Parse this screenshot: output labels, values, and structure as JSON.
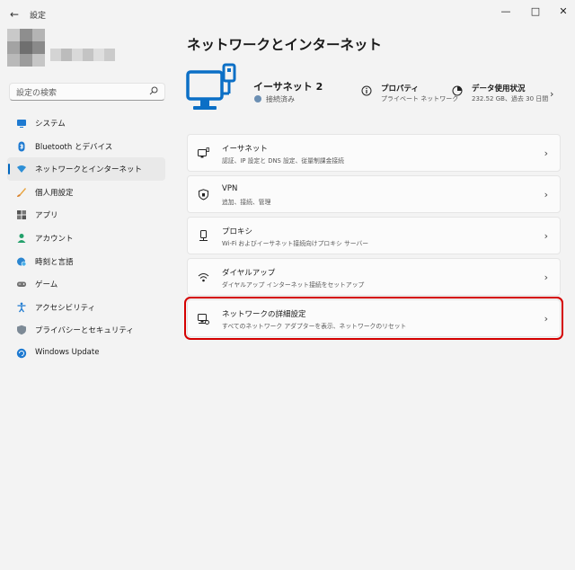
{
  "window": {
    "title": "設定",
    "back_glyph": "←",
    "controls": {
      "minimize": "—",
      "maximize": "□",
      "close": "✕"
    }
  },
  "sidebar": {
    "search": {
      "placeholder": "設定の検索"
    },
    "items": [
      {
        "label": "システム",
        "icon": "monitor-icon"
      },
      {
        "label": "Bluetooth とデバイス",
        "icon": "bluetooth-icon"
      },
      {
        "label": "ネットワークとインターネット",
        "icon": "wifi-icon",
        "active": true
      },
      {
        "label": "個人用設定",
        "icon": "brush-icon"
      },
      {
        "label": "アプリ",
        "icon": "apps-icon"
      },
      {
        "label": "アカウント",
        "icon": "person-icon"
      },
      {
        "label": "時刻と言語",
        "icon": "globe-clock-icon"
      },
      {
        "label": "ゲーム",
        "icon": "gamepad-icon"
      },
      {
        "label": "アクセシビリティ",
        "icon": "accessibility-icon"
      },
      {
        "label": "プライバシーとセキュリティ",
        "icon": "shield-icon"
      },
      {
        "label": "Windows Update",
        "icon": "update-icon"
      }
    ]
  },
  "main": {
    "title": "ネットワークとインターネット",
    "connection": {
      "name": "イーサネット 2",
      "status": "接続済み"
    },
    "properties": {
      "title": "プロパティ",
      "subtitle": "プライベート ネットワーク"
    },
    "data_usage": {
      "title": "データ使用状況",
      "subtitle": "232.52 GB、過去 30 日間"
    },
    "chevron": "›",
    "cards": [
      {
        "title": "イーサネット",
        "subtitle": "認証、IP 設定と DNS 設定、従量制課金接続",
        "icon": "ethernet-icon"
      },
      {
        "title": "VPN",
        "subtitle": "追加、接続、管理",
        "icon": "vpn-shield-icon"
      },
      {
        "title": "プロキシ",
        "subtitle": "Wi-Fi およびイーサネット接続向けプロキシ サーバー",
        "icon": "proxy-icon"
      },
      {
        "title": "ダイヤルアップ",
        "subtitle": "ダイヤルアップ インターネット接続をセットアップ",
        "icon": "dialup-icon"
      },
      {
        "title": "ネットワークの詳細設定",
        "subtitle": "すべてのネットワーク アダプターを表示、ネットワークのリセット",
        "icon": "advanced-network-icon",
        "highlighted": true
      }
    ]
  },
  "colors": {
    "accent": "#0067c0",
    "highlight_border": "#d40000",
    "background": "#f3f3f3"
  }
}
